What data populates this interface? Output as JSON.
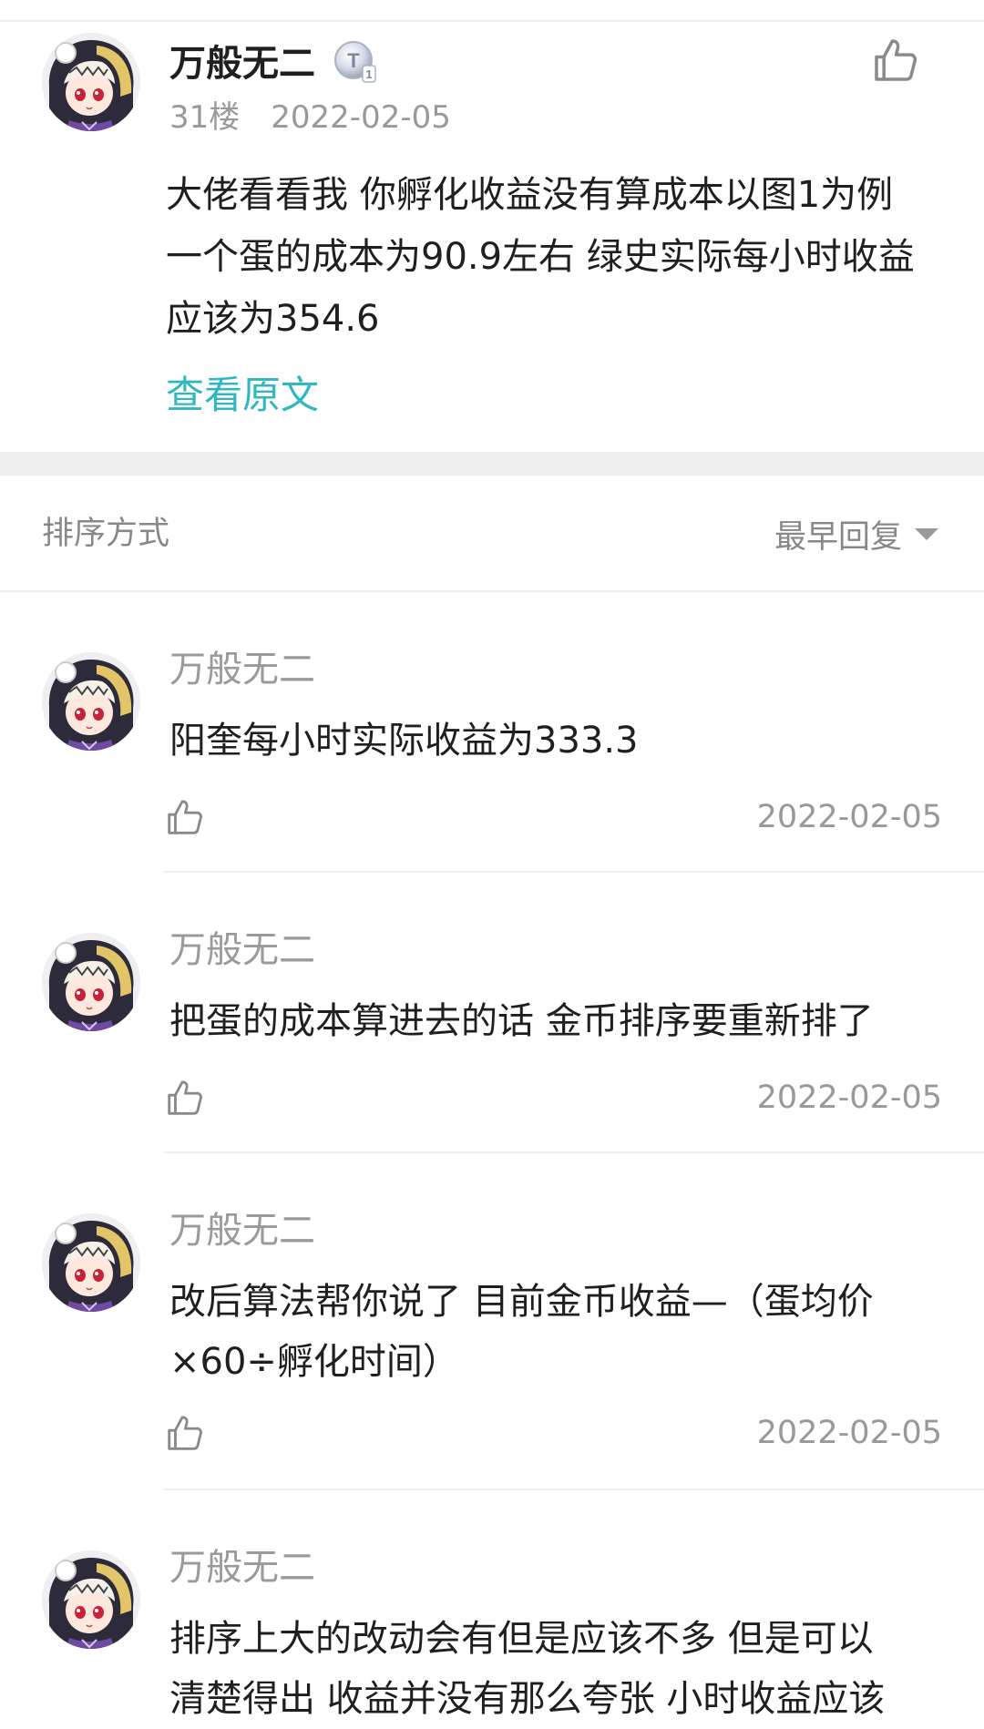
{
  "post": {
    "username": "万般无二",
    "level_badge": "T1",
    "floor": "31楼",
    "date": "2022-02-05",
    "content": "大佬看看我 你孵化收益没有算成本以图1为例\n一个蛋的成本为90.9左右 绿史实际每小时收益\n应该为354.6",
    "view_original": "查看原文",
    "like_icon": "thumbs-up-icon"
  },
  "sort": {
    "label": "排序方式",
    "selected": "最早回复"
  },
  "replies": [
    {
      "username": "万般无二",
      "text": "阳奎每小时实际收益为333.3",
      "date": "2022-02-05"
    },
    {
      "username": "万般无二",
      "text": "把蛋的成本算进去的话 金币排序要重新排了",
      "date": "2022-02-05"
    },
    {
      "username": "万般无二",
      "text": "改后算法帮你说了 目前金币收益—（蛋均价\n×60÷孵化时间）",
      "date": "2022-02-05"
    },
    {
      "username": "万般无二",
      "text": "排序上大的改动会有但是应该不多 但是可以\n清楚得出 收益并没有那么夸张 小时收益应该",
      "date": ""
    }
  ],
  "colors": {
    "accent_link": "#2fb8c0",
    "muted_text": "#999999",
    "divider": "#eeeeee"
  }
}
